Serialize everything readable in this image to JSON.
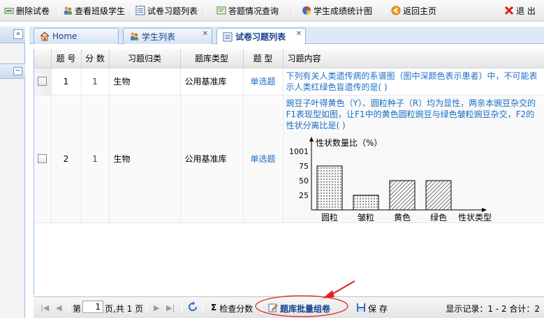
{
  "toolbar": {
    "delete_label": "删除试卷",
    "view_class_label": "查看班级学生",
    "exercises_label": "试卷习题列表",
    "answers_label": "答题情况查询",
    "stats_label": "学生成绩统计图",
    "home_label": "返回主页",
    "exit_label": "退 出"
  },
  "tabs": [
    {
      "label": "Home"
    },
    {
      "label": "学生列表"
    },
    {
      "label": "试卷习题列表"
    }
  ],
  "grid": {
    "headers": [
      "题 号",
      "分 数",
      "习题归类",
      "题库类型",
      "题 型",
      "习题内容"
    ],
    "rows": [
      {
        "num": "1",
        "score": "1",
        "category": "生物",
        "bank_type": "公用基准库",
        "kind": "单选题",
        "content": "下列有关人类遗传病的系谱图（图中深颜色表示患者）中，不可能表示人类红绿色盲遗传的是(      )"
      },
      {
        "num": "2",
        "score": "1",
        "category": "生物",
        "bank_type": "公用基准库",
        "kind": "单选题",
        "content": "豌豆子叶得黄色（Y）、圆粒种子（R）均为显性，两亲本豌豆杂交的F1表现型如图，让F1中的黄色圆粒豌豆与绿色皱粒豌豆杂交，F2的性状分离比是(      )"
      }
    ]
  },
  "chart_data": {
    "type": "bar",
    "ylabel": "性状数量比（%）",
    "xlabel": "性状类型",
    "yticks": [
      "25",
      "50",
      "75",
      "1001"
    ],
    "ylim": [
      0,
      100
    ],
    "categories": [
      "圆粒",
      "皱粒",
      "黄色",
      "绿色"
    ],
    "values": [
      75,
      25,
      50,
      50
    ],
    "trailing": "..."
  },
  "pager": {
    "page_label": "第",
    "page_value": "1",
    "page_suffix": "页,共 1 页",
    "check_score_label": "检查分数",
    "batch_label": "题库批量组卷",
    "save_label": "保 存",
    "summary": "显示记录：1 - 2 合计：2"
  }
}
